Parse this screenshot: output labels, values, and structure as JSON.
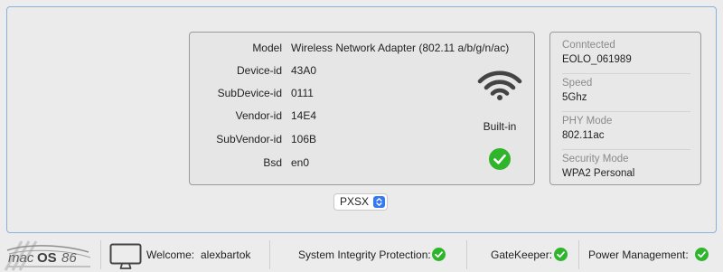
{
  "device_info": [
    {
      "label": "Model",
      "value": "Wireless Network Adapter (802.11 a/b/g/n/ac)"
    },
    {
      "label": "Device-id",
      "value": "43A0"
    },
    {
      "label": "SubDevice-id",
      "value": "0111"
    },
    {
      "label": "Vendor-id",
      "value": "14E4"
    },
    {
      "label": "SubVendor-id",
      "value": "106B"
    },
    {
      "label": "Bsd",
      "value": "en0"
    }
  ],
  "builtin_label": "Built-in",
  "status": [
    {
      "label": "Conntected",
      "value": "EOLO_061989"
    },
    {
      "label": "Speed",
      "value": "5Ghz"
    },
    {
      "label": "PHY Mode",
      "value": "802.11ac"
    },
    {
      "label": "Security Mode",
      "value": "WPA2 Personal"
    }
  ],
  "device_selector": {
    "value": "PXSX"
  },
  "footer": {
    "welcome_label": "Welcome:",
    "username": "alexbartok",
    "sip_label": "System Integrity Protection:",
    "gatekeeper_label": "GateKeeper:",
    "power_label": "Power Management:"
  },
  "icons": {
    "wifi": "wifi-icon",
    "check": "check-circle-icon",
    "monitor": "monitor-icon",
    "logo": "macos86-logo"
  },
  "colors": {
    "accent": "#3478f6",
    "success": "#2fb52c",
    "panel_border": "#8ab0de"
  }
}
